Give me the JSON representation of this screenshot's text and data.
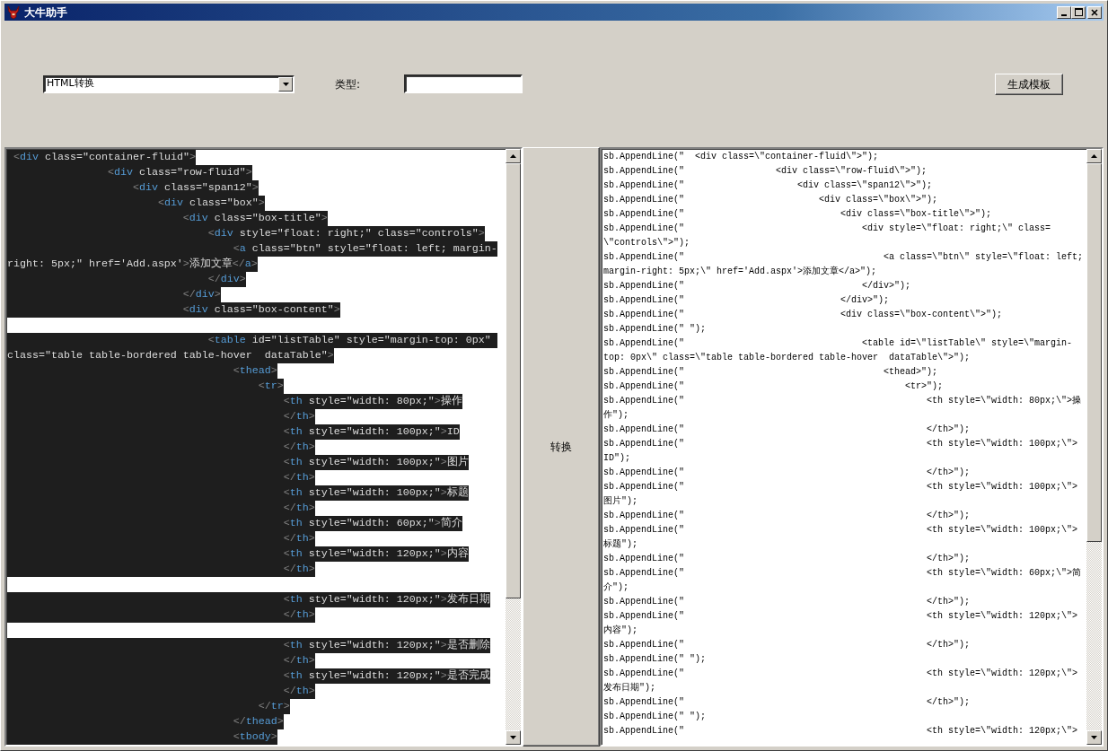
{
  "window": {
    "title": "大牛助手"
  },
  "toolbar": {
    "mode_select": {
      "value": "HTML转换"
    },
    "type_field": {
      "label": "类型:"
    },
    "generate_button": "生成模板"
  },
  "source_editor": {
    "lines": [
      {
        "kind": "code",
        "text": " <div class=\"container-fluid\">",
        "selected": true
      },
      {
        "kind": "code",
        "text": "                <div class=\"row-fluid\">",
        "selected": true
      },
      {
        "kind": "code",
        "text": "                    <div class=\"span12\">",
        "selected": true
      },
      {
        "kind": "code",
        "text": "                        <div class=\"box\">",
        "selected": true
      },
      {
        "kind": "code",
        "text": "                            <div class=\"box-title\">",
        "selected": true
      },
      {
        "kind": "code",
        "text": "                                <div style=\"float: right;\" class=\"controls\">",
        "selected": true
      },
      {
        "kind": "code",
        "text": "                                    <a class=\"btn\" style=\"float: left; margin-",
        "selected": true
      },
      {
        "kind": "code",
        "text": "right: 5px;\" href='Add.aspx'>添加文章</a>",
        "selected": true
      },
      {
        "kind": "code",
        "text": "                                </div>",
        "selected": true
      },
      {
        "kind": "code",
        "text": "                            </div>",
        "selected": true
      },
      {
        "kind": "code",
        "text": "                            <div class=\"box-content\">",
        "selected": true
      },
      {
        "kind": "blank"
      },
      {
        "kind": "code",
        "text": "                                <table id=\"listTable\" style=\"margin-top: 0px\" ",
        "selected": true
      },
      {
        "kind": "code",
        "text": "class=\"table table-bordered table-hover  dataTable\">",
        "selected": true
      },
      {
        "kind": "code",
        "text": "                                    <thead>",
        "selected": true
      },
      {
        "kind": "code",
        "text": "                                        <tr>",
        "selected": true
      },
      {
        "kind": "code",
        "text": "                                            <th style=\"width: 80px;\">操作",
        "selected": true
      },
      {
        "kind": "code",
        "text": "                                            </th>",
        "selected": true
      },
      {
        "kind": "code",
        "text": "                                            <th style=\"width: 100px;\">ID",
        "selected": true
      },
      {
        "kind": "code",
        "text": "                                            </th>",
        "selected": true
      },
      {
        "kind": "code",
        "text": "                                            <th style=\"width: 100px;\">图片",
        "selected": true
      },
      {
        "kind": "code",
        "text": "                                            </th>",
        "selected": true
      },
      {
        "kind": "code",
        "text": "                                            <th style=\"width: 100px;\">标题",
        "selected": true
      },
      {
        "kind": "code",
        "text": "                                            </th>",
        "selected": true
      },
      {
        "kind": "code",
        "text": "                                            <th style=\"width: 60px;\">简介",
        "selected": true
      },
      {
        "kind": "code",
        "text": "                                            </th>",
        "selected": true
      },
      {
        "kind": "code",
        "text": "                                            <th style=\"width: 120px;\">内容",
        "selected": true
      },
      {
        "kind": "code",
        "text": "                                            </th>",
        "selected": true
      },
      {
        "kind": "blank"
      },
      {
        "kind": "code",
        "text": "                                            <th style=\"width: 120px;\">发布日期",
        "selected": true
      },
      {
        "kind": "code",
        "text": "                                            </th>",
        "selected": true
      },
      {
        "kind": "blank"
      },
      {
        "kind": "code",
        "text": "                                            <th style=\"width: 120px;\">是否删除",
        "selected": true
      },
      {
        "kind": "code",
        "text": "                                            </th>",
        "selected": true
      },
      {
        "kind": "code",
        "text": "                                            <th style=\"width: 120px;\">是否完成",
        "selected": true
      },
      {
        "kind": "code",
        "text": "                                            </th>",
        "selected": true
      },
      {
        "kind": "code",
        "text": "                                        </tr>",
        "selected": true
      },
      {
        "kind": "code",
        "text": "                                    </thead>",
        "selected": true
      },
      {
        "kind": "code",
        "text": "                                    <tbody>",
        "selected": true
      }
    ]
  },
  "convert_button": "转换",
  "output_editor": {
    "lines": [
      "sb.AppendLine(\"  <div class=\\\"container-fluid\\\">\");",
      "sb.AppendLine(\"                 <div class=\\\"row-fluid\\\">\");",
      "sb.AppendLine(\"                     <div class=\\\"span12\\\">\");",
      "sb.AppendLine(\"                         <div class=\\\"box\\\">\");",
      "sb.AppendLine(\"                             <div class=\\\"box-title\\\">\");",
      "sb.AppendLine(\"                                 <div style=\\\"float: right;\\\" class=",
      "\\\"controls\\\">\");",
      "sb.AppendLine(\"                                     <a class=\\\"btn\\\" style=\\\"float: left;",
      "margin-right: 5px;\\\" href='Add.aspx'>添加文章</a>\");",
      "sb.AppendLine(\"                                 </div>\");",
      "sb.AppendLine(\"                             </div>\");",
      "sb.AppendLine(\"                             <div class=\\\"box-content\\\">\");",
      "sb.AppendLine(\" \");",
      "sb.AppendLine(\"                                 <table id=\\\"listTable\\\" style=\\\"margin-",
      "top: 0px\\\" class=\\\"table table-bordered table-hover  dataTable\\\">\");",
      "sb.AppendLine(\"                                     <thead>\");",
      "sb.AppendLine(\"                                         <tr>\");",
      "sb.AppendLine(\"                                             <th style=\\\"width: 80px;\\\">操",
      "作\");",
      "sb.AppendLine(\"                                             </th>\");",
      "sb.AppendLine(\"                                             <th style=\\\"width: 100px;\\\">",
      "ID\");",
      "sb.AppendLine(\"                                             </th>\");",
      "sb.AppendLine(\"                                             <th style=\\\"width: 100px;\\\">",
      "图片\");",
      "sb.AppendLine(\"                                             </th>\");",
      "sb.AppendLine(\"                                             <th style=\\\"width: 100px;\\\">",
      "标题\");",
      "sb.AppendLine(\"                                             </th>\");",
      "sb.AppendLine(\"                                             <th style=\\\"width: 60px;\\\">简",
      "介\");",
      "sb.AppendLine(\"                                             </th>\");",
      "sb.AppendLine(\"                                             <th style=\\\"width: 120px;\\\">",
      "内容\");",
      "sb.AppendLine(\"                                             </th>\");",
      "sb.AppendLine(\" \");",
      "sb.AppendLine(\"                                             <th style=\\\"width: 120px;\\\">",
      "发布日期\");",
      "sb.AppendLine(\"                                             </th>\");",
      "sb.AppendLine(\" \");",
      "sb.AppendLine(\"                                             <th style=\\\"width: 120px;\\\">"
    ]
  }
}
